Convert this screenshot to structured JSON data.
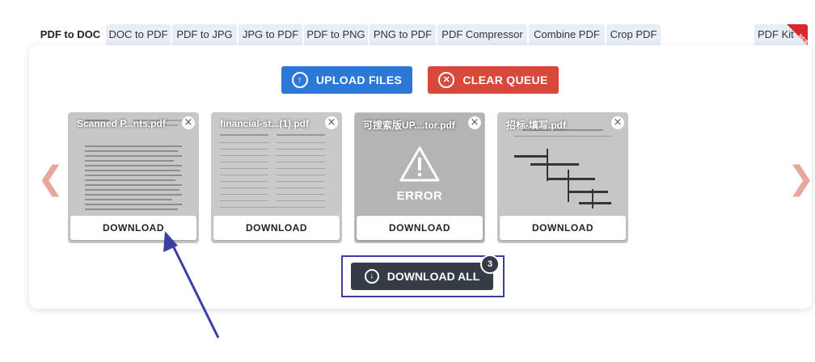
{
  "tabs": [
    {
      "label": "PDF to DOC",
      "active": true
    },
    {
      "label": "DOC to PDF"
    },
    {
      "label": "PDF to JPG"
    },
    {
      "label": "JPG to PDF"
    },
    {
      "label": "PDF to PNG"
    },
    {
      "label": "PNG to PDF"
    },
    {
      "label": "PDF Compressor"
    },
    {
      "label": "Combine PDF"
    },
    {
      "label": "Crop PDF"
    },
    {
      "label": "PDF Kit",
      "badge": "NEW"
    }
  ],
  "toolbar": {
    "upload_label": "UPLOAD FILES",
    "clear_label": "CLEAR QUEUE"
  },
  "files": [
    {
      "name": "Scanned P...nts.pdf",
      "download_label": "DOWNLOAD"
    },
    {
      "name": "financial-st...(1).pdf",
      "download_label": "DOWNLOAD"
    },
    {
      "name": "可搜索版UP....tor.pdf",
      "status": "ERROR",
      "download_label": "DOWNLOAD"
    },
    {
      "name": "招标-填写.pdf",
      "download_label": "DOWNLOAD"
    }
  ],
  "download_all": {
    "label": "DOWNLOAD ALL",
    "count": "3"
  },
  "colors": {
    "upload": "#2b78d6",
    "clear": "#d9493b",
    "download_all": "#353c46",
    "annotation": "#3b3fa6"
  }
}
